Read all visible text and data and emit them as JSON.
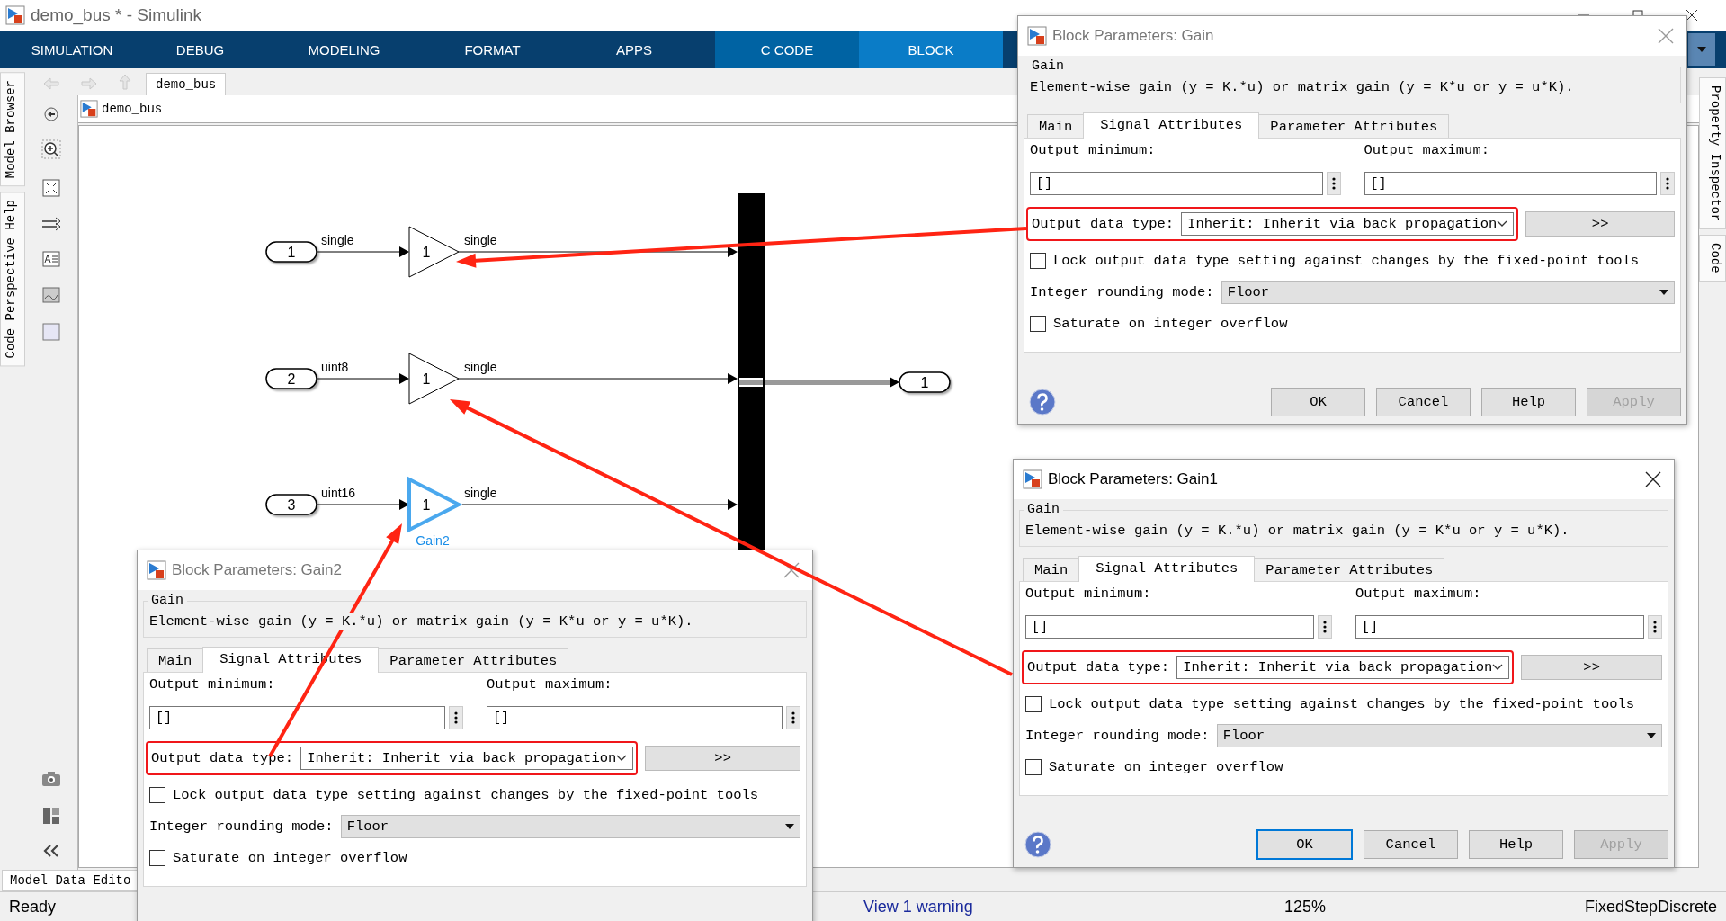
{
  "window": {
    "title": "demo_bus * - Simulink"
  },
  "ribbon_tabs": [
    {
      "label": "SIMULATION",
      "kind": "standard",
      "selected": false
    },
    {
      "label": "DEBUG",
      "kind": "standard",
      "selected": false
    },
    {
      "label": "MODELING",
      "kind": "standard",
      "selected": false
    },
    {
      "label": "FORMAT",
      "kind": "standard",
      "selected": false
    },
    {
      "label": "APPS",
      "kind": "standard",
      "selected": false
    },
    {
      "label": "C CODE",
      "kind": "app",
      "selected": false
    },
    {
      "label": "BLOCK",
      "kind": "contextual",
      "selected": true
    }
  ],
  "left_panel_tabs": [
    "Model Browser",
    "Code Perspective Help"
  ],
  "right_panel_tabs": [
    "Property Inspector",
    "Code"
  ],
  "breadcrumb_tab": "demo_bus",
  "address": "demo_bus",
  "diagram": {
    "rows": [
      {
        "inport": "1",
        "in_signal": "single",
        "gain": "1",
        "out_signal": "single",
        "selected": false
      },
      {
        "inport": "2",
        "in_signal": "uint8",
        "gain": "1",
        "out_signal": "single",
        "selected": false
      },
      {
        "inport": "3",
        "in_signal": "uint16",
        "gain": "1",
        "out_signal": "single",
        "selected": true,
        "label": "Gain2"
      }
    ],
    "outport": "1"
  },
  "dialogs": [
    {
      "title": "Block Parameters: Gain2",
      "active": false,
      "group": "Gain",
      "description": "Element-wise gain (y = K.*u) or matrix gain (y = K*u or y = u*K).",
      "tabs": [
        {
          "label": "Main",
          "selected": false
        },
        {
          "label": "Signal Attributes",
          "selected": true
        },
        {
          "label": "Parameter Attributes",
          "selected": false
        }
      ],
      "min_label": "Output minimum:",
      "min_value": "[]",
      "max_label": "Output maximum:",
      "max_value": "[]",
      "data_type_label": "Output data type:",
      "data_type_value": "Inherit: Inherit via back propagation",
      "more_button": ">>",
      "lock_label": "Lock output data type setting against changes by the fixed-point tools",
      "lock_checked": false,
      "rounding_label": "Integer rounding mode:",
      "rounding_value": "Floor",
      "saturate_label": "Saturate on integer overflow",
      "saturate_checked": false
    },
    {
      "title": "Block Parameters: Gain",
      "active": false,
      "group": "Gain",
      "description": "Element-wise gain (y = K.*u) or matrix gain (y = K*u or y = u*K).",
      "tabs": [
        {
          "label": "Main",
          "selected": false
        },
        {
          "label": "Signal Attributes",
          "selected": true
        },
        {
          "label": "Parameter Attributes",
          "selected": false
        }
      ],
      "min_label": "Output minimum:",
      "min_value": "[]",
      "max_label": "Output maximum:",
      "max_value": "[]",
      "data_type_label": "Output data type:",
      "data_type_value": "Inherit: Inherit via back propagation",
      "more_button": ">>",
      "lock_label": "Lock output data type setting against changes by the fixed-point tools",
      "lock_checked": false,
      "rounding_label": "Integer rounding mode:",
      "rounding_value": "Floor",
      "saturate_label": "Saturate on integer overflow",
      "saturate_checked": false,
      "buttons": [
        {
          "label": "OK",
          "focused": false,
          "disabled": false
        },
        {
          "label": "Cancel",
          "focused": false,
          "disabled": false
        },
        {
          "label": "Help",
          "focused": false,
          "disabled": false
        },
        {
          "label": "Apply",
          "focused": false,
          "disabled": true
        }
      ]
    },
    {
      "title": "Block Parameters: Gain1",
      "active": true,
      "group": "Gain",
      "description": "Element-wise gain (y = K.*u) or matrix gain (y = K*u or y = u*K).",
      "tabs": [
        {
          "label": "Main",
          "selected": false
        },
        {
          "label": "Signal Attributes",
          "selected": true
        },
        {
          "label": "Parameter Attributes",
          "selected": false
        }
      ],
      "min_label": "Output minimum:",
      "min_value": "[]",
      "max_label": "Output maximum:",
      "max_value": "[]",
      "data_type_label": "Output data type:",
      "data_type_value": "Inherit: Inherit via back propagation",
      "more_button": ">>",
      "lock_label": "Lock output data type setting against changes by the fixed-point tools",
      "lock_checked": false,
      "rounding_label": "Integer rounding mode:",
      "rounding_value": "Floor",
      "saturate_label": "Saturate on integer overflow",
      "saturate_checked": false,
      "buttons": [
        {
          "label": "OK",
          "focused": true,
          "disabled": false
        },
        {
          "label": "Cancel",
          "focused": false,
          "disabled": false
        },
        {
          "label": "Help",
          "focused": false,
          "disabled": false
        },
        {
          "label": "Apply",
          "focused": false,
          "disabled": true
        }
      ]
    }
  ],
  "bottom_tab": "Model Data Edito",
  "status_bar": {
    "state": "Ready",
    "warning": "View 1 warning",
    "zoom": "125%",
    "solver": "FixedStepDiscrete"
  }
}
